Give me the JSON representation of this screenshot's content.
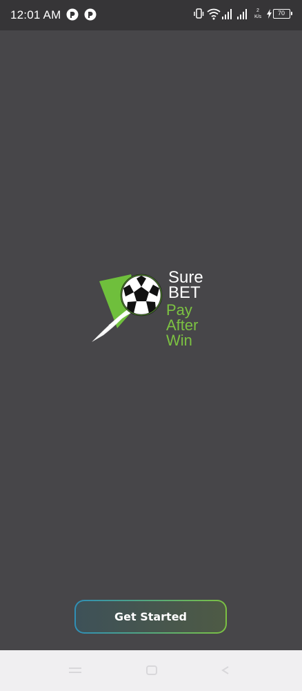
{
  "status_bar": {
    "time": "12:01 AM",
    "notification_icons": [
      "app-notification-icon",
      "app-notification-icon"
    ],
    "indicators": [
      "vibrate-icon",
      "wifi-icon",
      "signal-icon",
      "signal-icon"
    ],
    "net_speed_value": "2",
    "net_speed_unit": "K/s",
    "battery_level": "70",
    "charging": true
  },
  "logo": {
    "icon": "soccer-ball-icon",
    "line1": "Sure",
    "line2": "BET",
    "line3": "Pay",
    "line4": "After",
    "line5": "Win",
    "colors": {
      "white": "#ffffff",
      "green": "#7cc242"
    }
  },
  "cta": {
    "label": "Get Started"
  },
  "nav_bar": {
    "buttons": [
      "recents-icon",
      "home-icon",
      "back-icon"
    ]
  },
  "colors": {
    "background": "#474649",
    "status_bar": "#363537",
    "nav_bar": "#f0eff1"
  }
}
